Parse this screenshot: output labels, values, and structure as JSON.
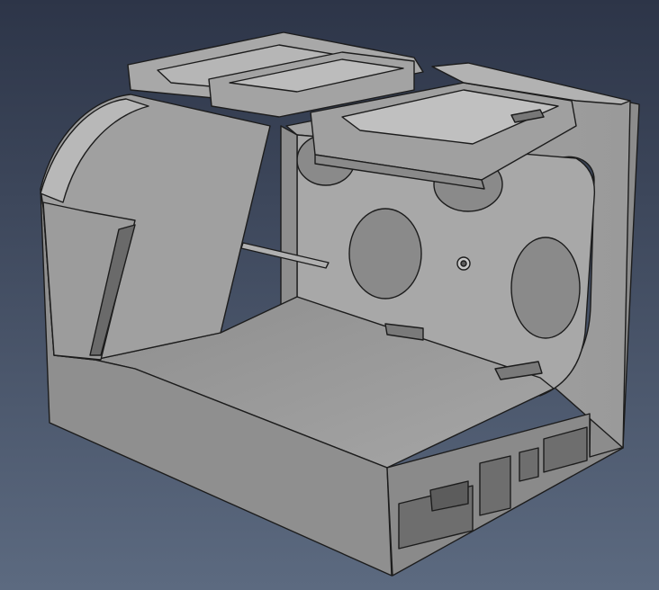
{
  "viewport": {
    "background_top": "#2d3548",
    "background_bottom": "#5c6a80"
  },
  "model": {
    "base_color": "#9a9a9a",
    "light_color": "#b4b4b4",
    "dark_color": "#6e6e6e",
    "edge_color": "#1c1c1c",
    "hole_color": "#8a8a8a"
  }
}
